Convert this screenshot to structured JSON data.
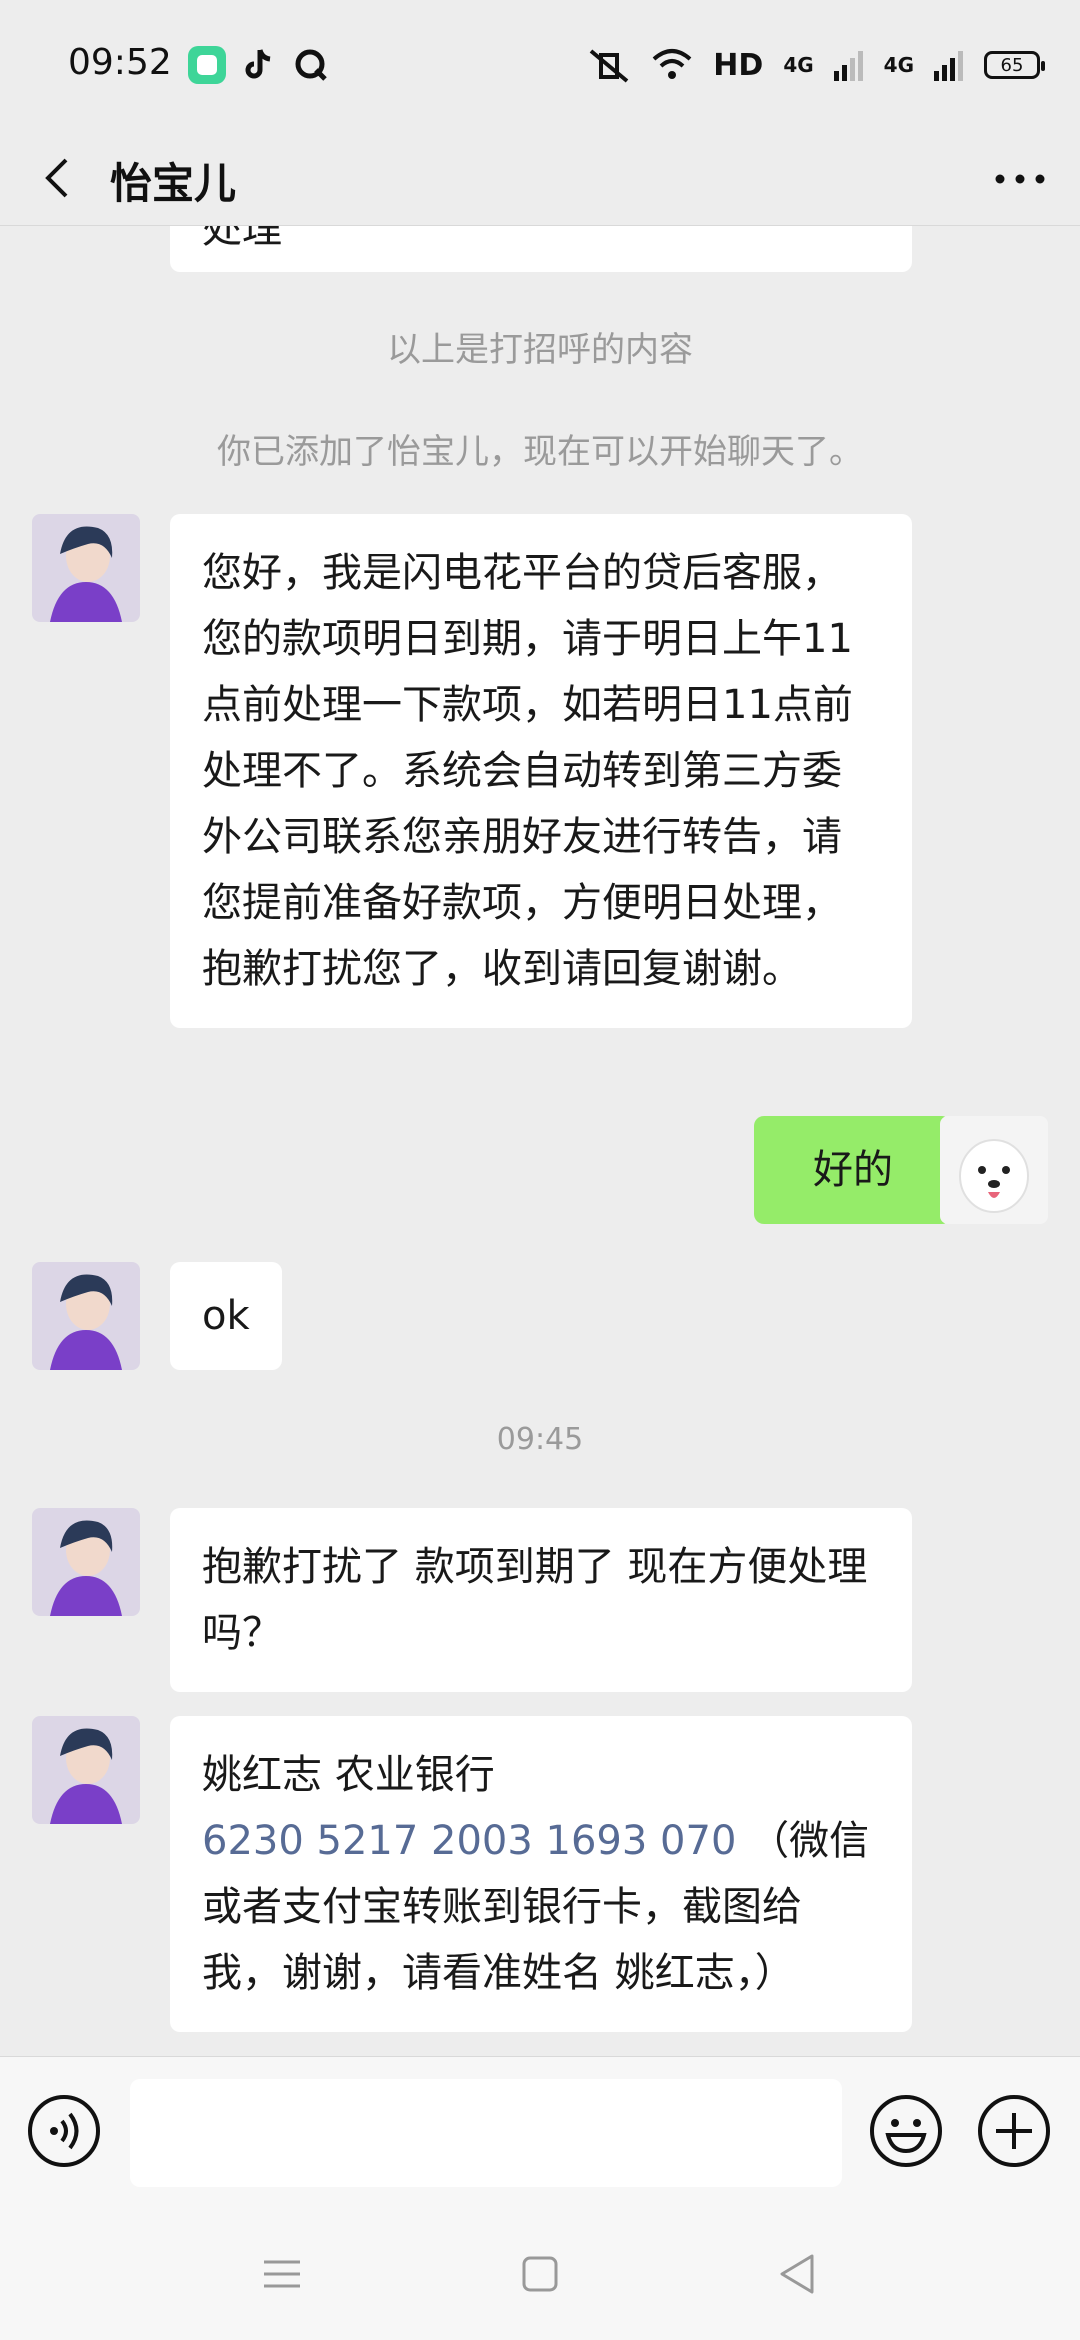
{
  "status_bar": {
    "time": "09:52",
    "hd_label": "HD",
    "network_1": "4G",
    "network_2": "4G",
    "battery": "65"
  },
  "header": {
    "title": "怡宝儿"
  },
  "messages": {
    "partial_text": "处理",
    "system_1": "以上是打招呼的内容",
    "system_2": "你已添加了怡宝儿，现在可以开始聊天了。",
    "msg_1": "您好，我是闪电花平台的贷后客服，您的款项明日到期，请于明日上午11点前处理一下款项，如若明日11点前处理不了。系统会自动转到第三方委外公司联系您亲朋好友进行转告，请您提前准备好款项，方便明日处理，抱歉打扰您了，收到请回复谢谢。",
    "msg_2_self": "好的",
    "msg_3": "ok",
    "timestamp": "09:45",
    "msg_4": "抱歉打扰了 款项到期了 现在方便处理吗？",
    "msg_5_line1": "姚红志 农业银行",
    "msg_5_account": "6230 5217 2003 1693 070",
    "msg_5_rest": "（微信或者支付宝转账到银行卡，截图给我，谢谢，请看准姓名  姚红志，）"
  },
  "input_bar": {
    "placeholder": ""
  },
  "icons": {
    "back": "chevron-left-icon",
    "more": "more-dots-icon",
    "voice": "voice-icon",
    "emoji": "emoji-icon",
    "plus": "plus-icon",
    "nav_menu": "menu-icon",
    "nav_home": "home-icon",
    "nav_back": "back-triangle-icon"
  },
  "colors": {
    "bubble_self": "#95ec69",
    "bubble_other": "#ffffff",
    "link": "#576b95",
    "background": "#ededed"
  }
}
